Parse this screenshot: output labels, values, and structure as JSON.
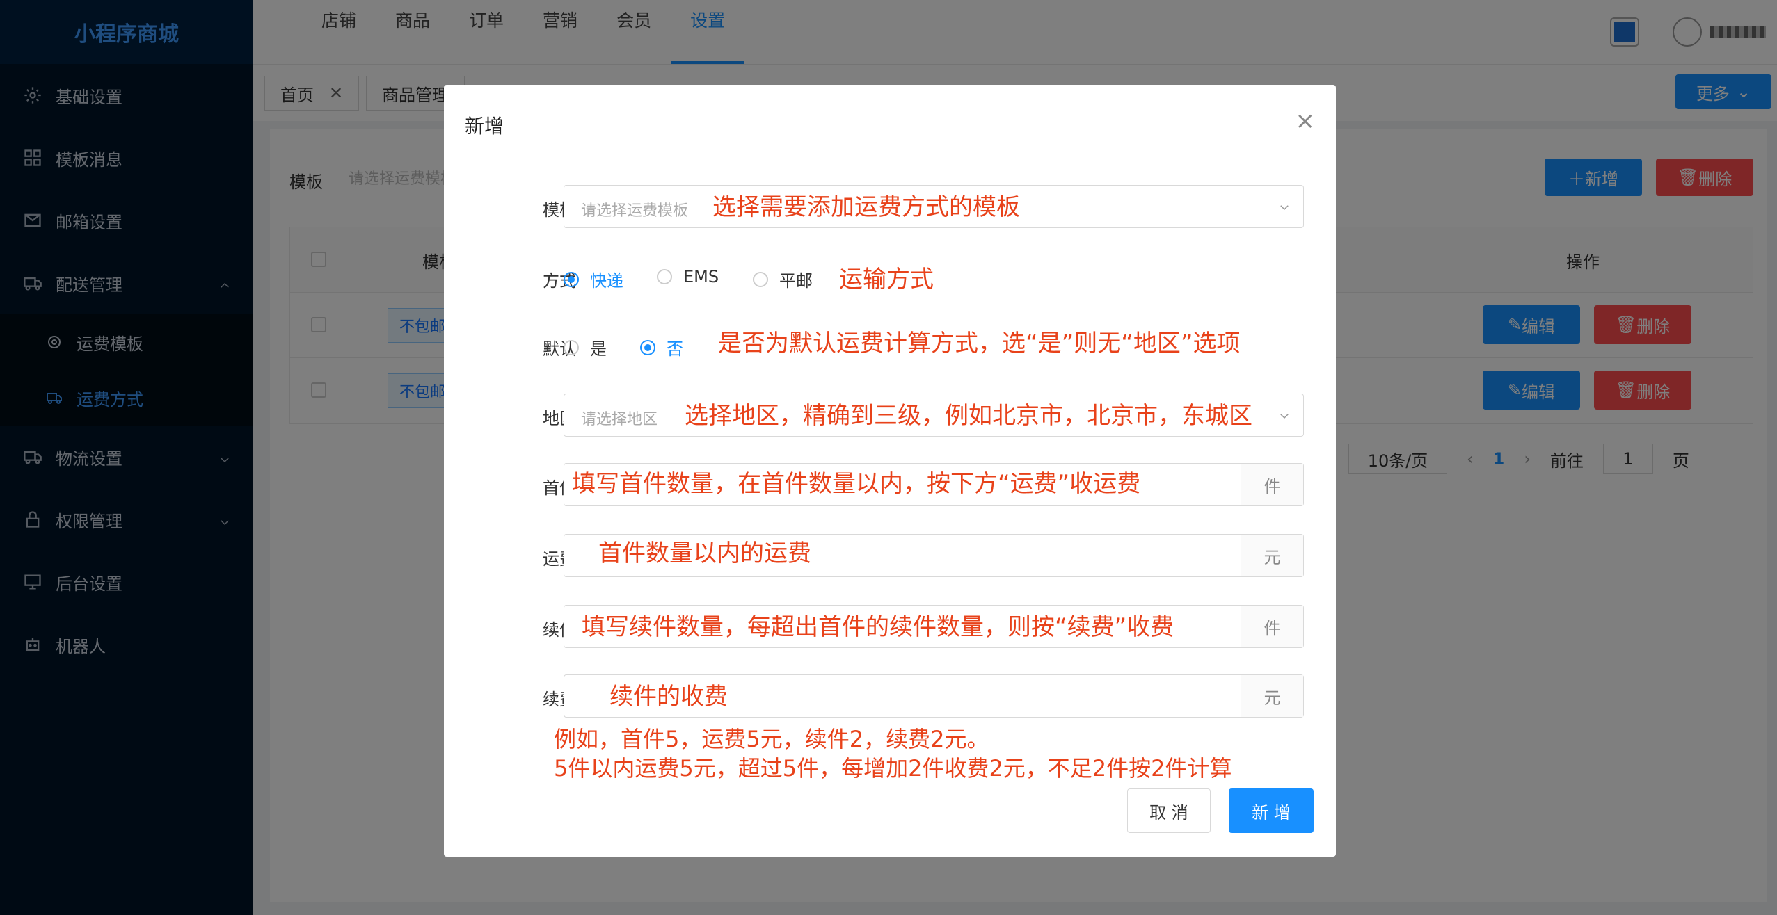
{
  "app": {
    "brand": "小程序商城"
  },
  "sidebar": {
    "items": [
      {
        "label": "基础设置",
        "icon": "gear-icon"
      },
      {
        "label": "模板消息",
        "icon": "grid-icon"
      },
      {
        "label": "邮箱设置",
        "icon": "mail-icon"
      },
      {
        "label": "配送管理",
        "icon": "truck-icon",
        "expanded": true,
        "children": [
          {
            "label": "运费模板",
            "icon": "circle-icon"
          },
          {
            "label": "运费方式",
            "icon": "truck-icon",
            "active": true
          }
        ]
      },
      {
        "label": "物流设置",
        "icon": "truck-icon"
      },
      {
        "label": "权限管理",
        "icon": "lock-icon"
      },
      {
        "label": "后台设置",
        "icon": "monitor-icon"
      },
      {
        "label": "机器人",
        "icon": "robot-icon"
      }
    ]
  },
  "topnav": {
    "items": [
      "店铺",
      "商品",
      "订单",
      "营销",
      "会员",
      "设置"
    ],
    "active": "设置"
  },
  "tabs": {
    "home": "首页",
    "second": "商品管理",
    "more": "更多"
  },
  "page": {
    "filter_label": "模板",
    "filter_placeholder": "请选择运费模板",
    "add_button": "新增",
    "delete_button": "删除",
    "table": {
      "col_template": "模板",
      "col_ops": "操作",
      "rows": [
        {
          "tag": "不包邮"
        },
        {
          "tag": "不包邮"
        }
      ],
      "edit_label": "编辑",
      "delete_label": "删除"
    },
    "pagination": {
      "page_size": "10条/页",
      "current_page": "1",
      "goto_label": "前往",
      "goto_value": "1",
      "page_suffix": "页"
    }
  },
  "modal": {
    "title": "新增",
    "template": {
      "label": "模板",
      "placeholder": "请选择运费模板",
      "annotation": "选择需要添加运费方式的模板"
    },
    "method": {
      "label": "方式",
      "options": [
        "快递",
        "EMS",
        "平邮"
      ],
      "selected": "快递",
      "annotation": "运输方式"
    },
    "default": {
      "label": "默认",
      "options": [
        "是",
        "否"
      ],
      "selected": "否",
      "annotation": "是否为默认运费计算方式，选“是”则无“地区”选项"
    },
    "region": {
      "label": "地区",
      "placeholder": "请选择地区",
      "annotation": "选择地区，精确到三级，例如北京市，北京市，东城区"
    },
    "first_piece": {
      "label": "首件",
      "suffix": "件",
      "annotation": "填写首件数量，在首件数量以内，按下方“运费”收运费"
    },
    "freight": {
      "label": "运费",
      "suffix": "元",
      "annotation": "首件数量以内的运费"
    },
    "additional_piece": {
      "label": "续件",
      "suffix": "件",
      "annotation": "填写续件数量，每超出首件的续件数量，则按“续费”收费"
    },
    "additional_fee": {
      "label": "续费",
      "suffix": "元",
      "annotation": "续件的收费"
    },
    "example_line1": "例如，首件5，运费5元，续件2，续费2元。",
    "example_line2": "5件以内运费5元，超过5件，每增加2件收费2元，不足2件按2件计算",
    "cancel_button": "取 消",
    "ok_button": "新 增"
  },
  "colors": {
    "primary": "#1890ff",
    "danger": "#ff4d4f",
    "annotation": "#e8421a",
    "sidebar_bg": "#001529"
  }
}
